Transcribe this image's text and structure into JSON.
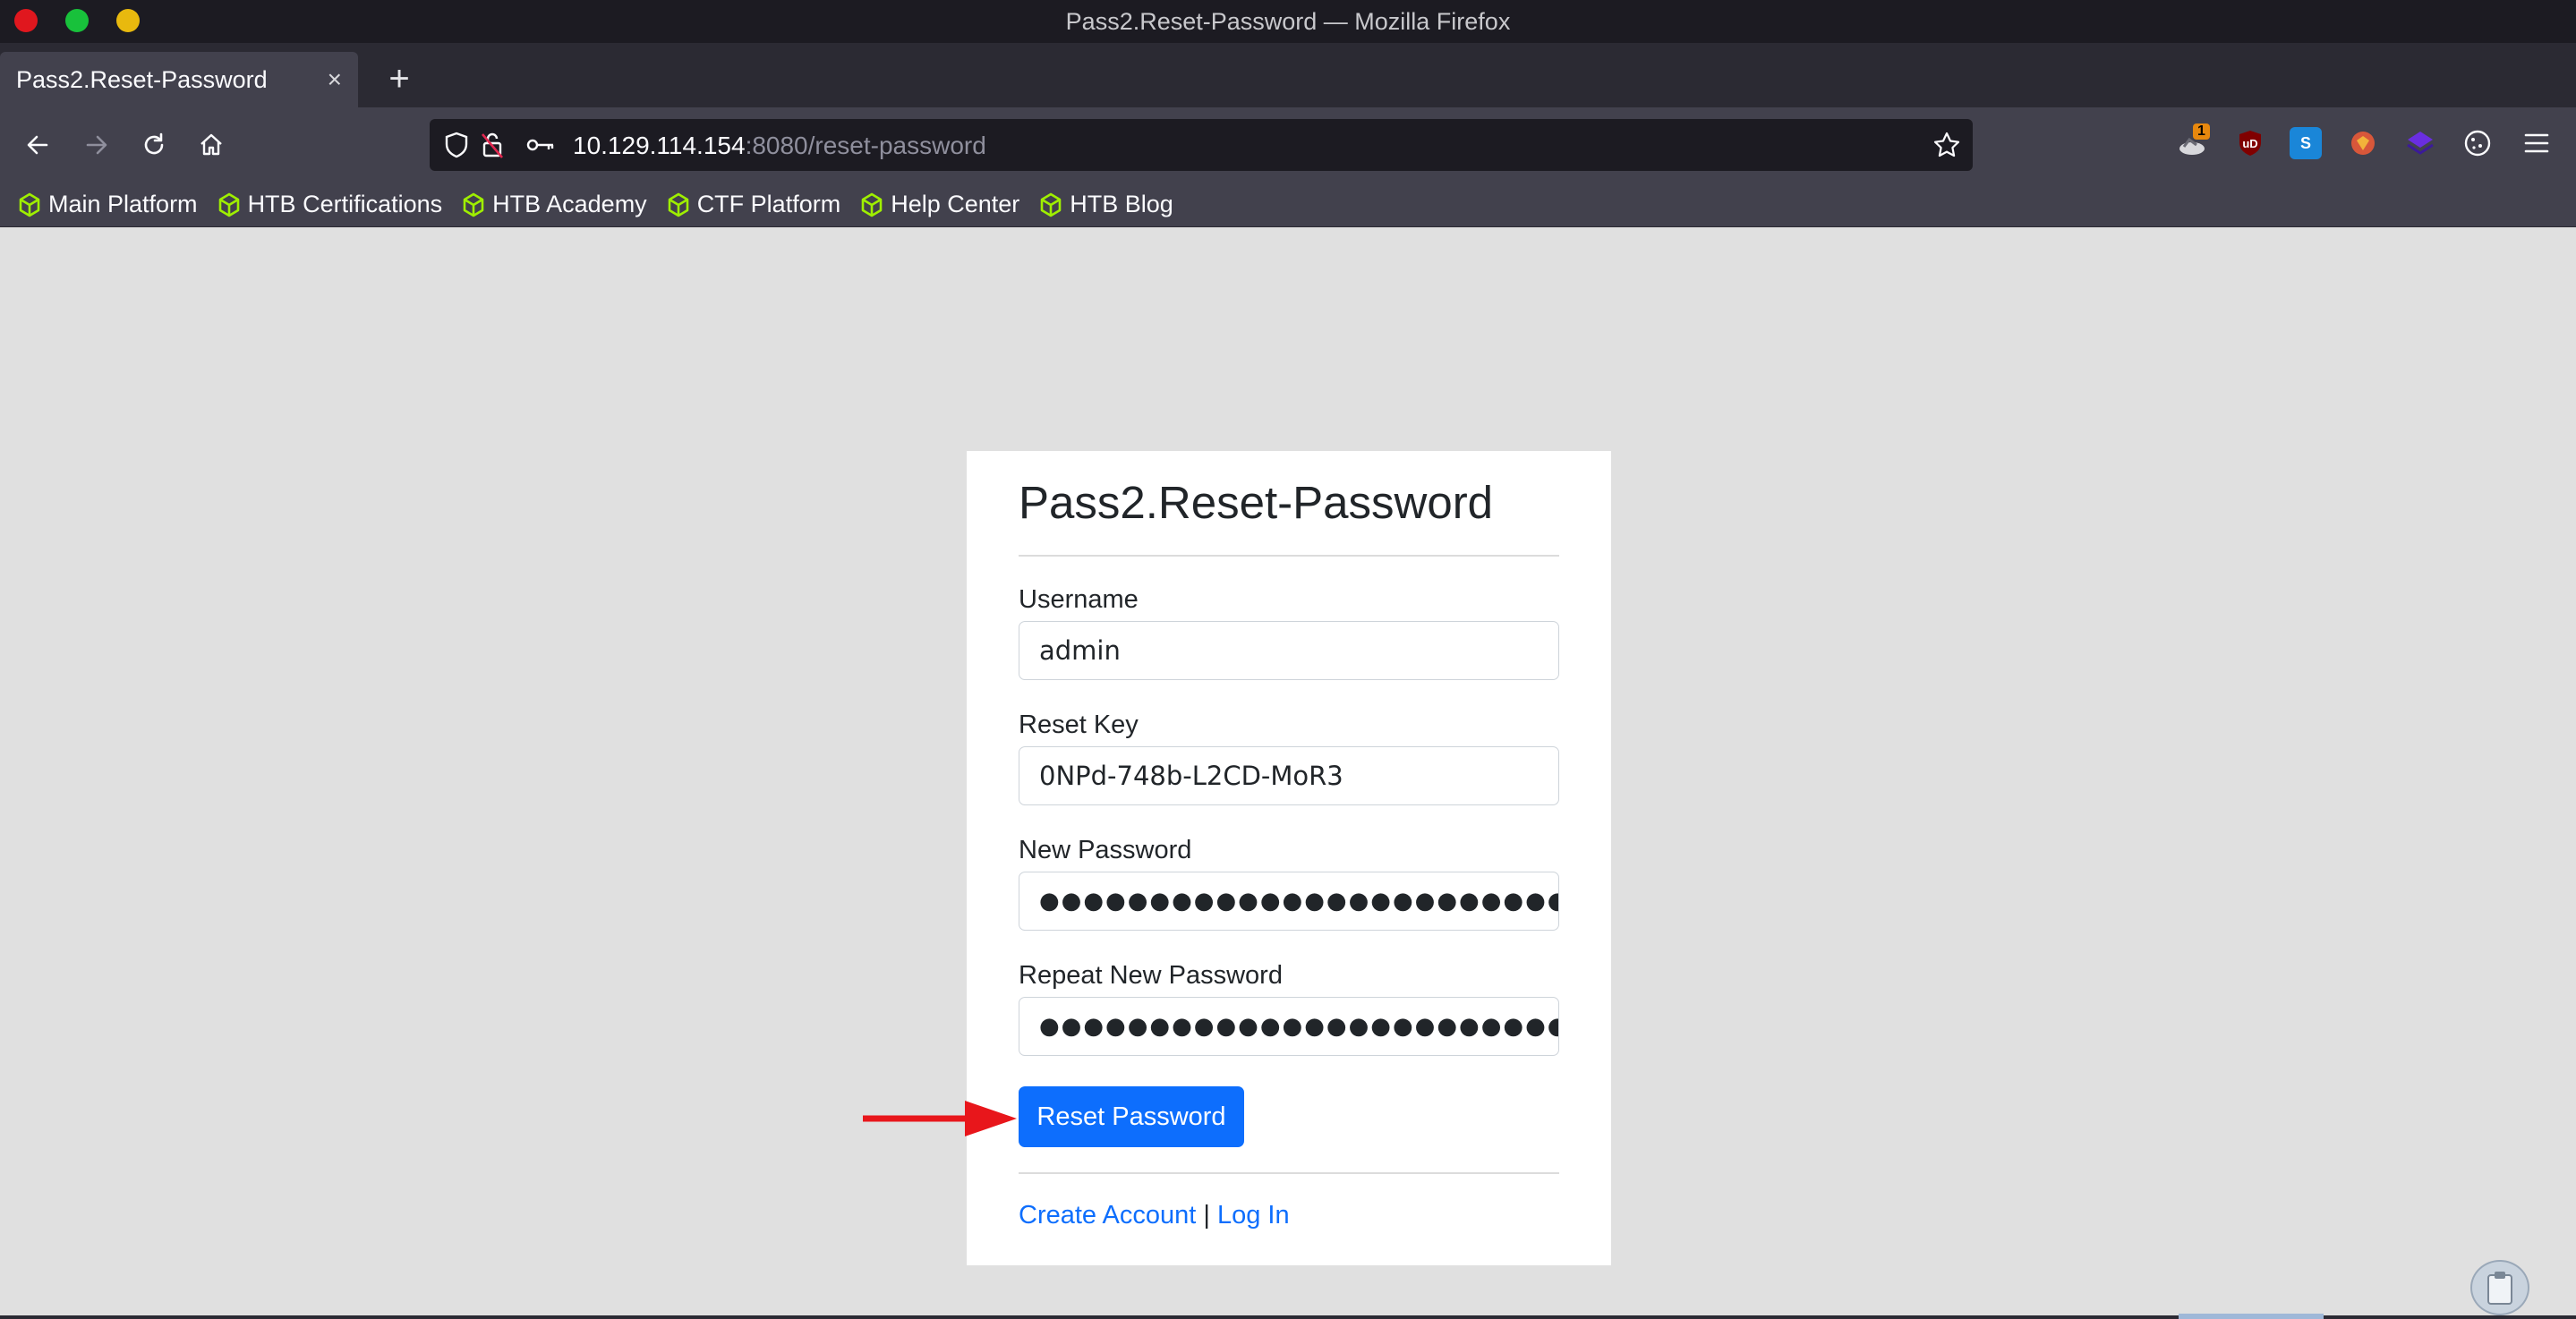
{
  "window": {
    "title": "Pass2.Reset-Password — Mozilla Firefox"
  },
  "tabs": [
    {
      "title": "Pass2.Reset-Password",
      "close": "×"
    }
  ],
  "new_tab": "+",
  "address_bar": {
    "host": "10.129.114.154",
    "path": ":8080/reset-password"
  },
  "extensions": {
    "badge_count": "1",
    "ublock_label": "uD",
    "s_label": "S"
  },
  "bookmarks": [
    "Main Platform",
    "HTB Certifications",
    "HTB Academy",
    "CTF Platform",
    "Help Center",
    "HTB Blog"
  ],
  "form": {
    "heading": "Pass2.Reset-Password",
    "username_label": "Username",
    "username_value": "admin",
    "reset_key_label": "Reset Key",
    "reset_key_value": "0NPd-748b-L2CD-MoR3",
    "new_password_label": "New Password",
    "new_password_value": "●●●●●●●●●●●●●●●●●●●●●●●●●●●●●●●●●●",
    "repeat_password_label": "Repeat New Password",
    "repeat_password_value": "●●●●●●●●●●●●●●●●●●●●●●●●●●●●●●●●●●",
    "submit_label": "Reset Password",
    "create_account_link": "Create Account",
    "separator": "|",
    "login_link": "Log In"
  },
  "colors": {
    "primary": "#0d6efd",
    "annotation_arrow": "#e8161b",
    "bookmark_icon": "#9fef00"
  }
}
